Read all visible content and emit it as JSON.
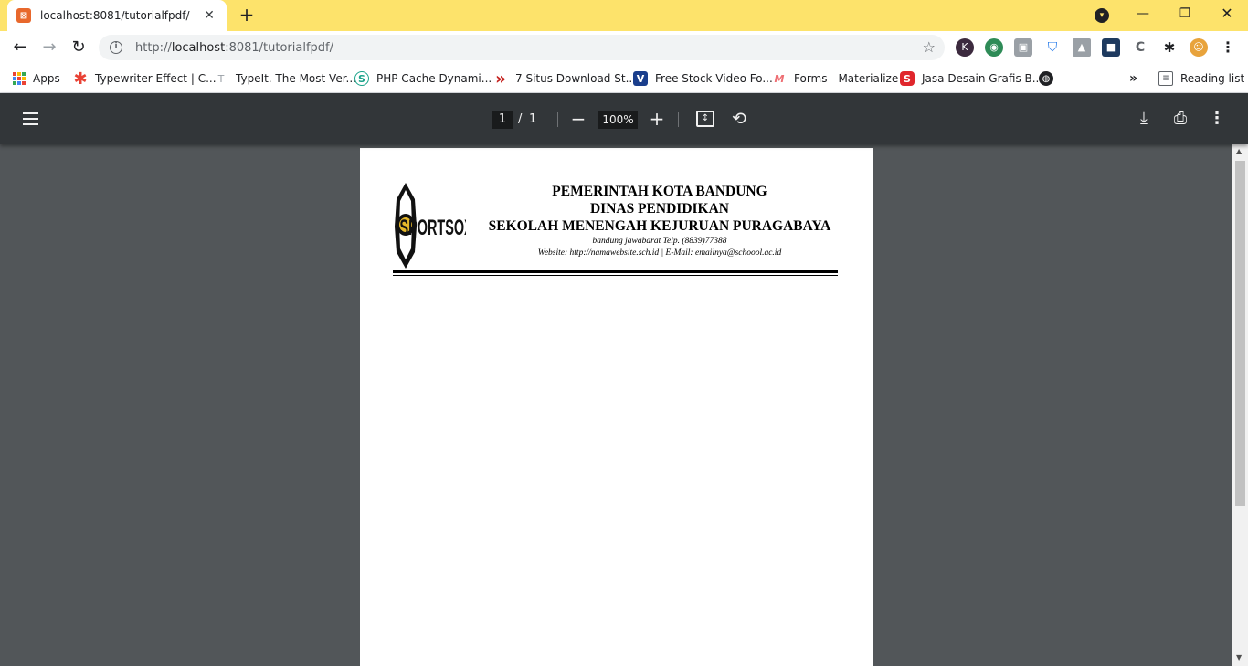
{
  "browser": {
    "tab_title": "localhost:8081/tutorialfpdf/",
    "tab_close": "✕",
    "new_tab": "+",
    "url_prefix": "http://",
    "url_host": "localhost",
    "url_rest": ":8081/tutorialfpdf/",
    "favicon_letter": "⊠"
  },
  "bookmarks": [
    {
      "label": "Apps",
      "icon": "apps-grid-icon"
    },
    {
      "label": "Typewriter Effect | C...",
      "icon": "asterisk-icon",
      "color": "#e94235"
    },
    {
      "label": "TypeIt. The Most Ver...",
      "icon": "t-letter-icon",
      "color": "#9aa0a6",
      "glyph": "T"
    },
    {
      "label": "PHP Cache Dynami...",
      "icon": "s-logo-icon",
      "color": "#1aa38a",
      "glyph": "S"
    },
    {
      "label": "7 Situs Download St...",
      "icon": "double-chevron-icon",
      "color": "#c5221f",
      "glyph": "»"
    },
    {
      "label": "Free Stock Video Fo...",
      "icon": "v-logo-icon",
      "color": "#1a3e8c",
      "glyph": "V"
    },
    {
      "label": "Forms - Materialize",
      "icon": "materialize-icon",
      "color": "#ee6e73",
      "glyph": "M"
    },
    {
      "label": "Jasa Desain Grafis B...",
      "icon": "s-red-icon",
      "color": "#e0262c",
      "glyph": "S"
    }
  ],
  "bookmarks_overflow": "»",
  "reading_list": "Reading list",
  "pdf_toolbar": {
    "page_current": "1",
    "page_separator": "/",
    "page_total": "1",
    "zoom": "100%"
  },
  "letterhead": {
    "logo_text": "SPORTSOX",
    "line1": "PEMERINTAH KOTA BANDUNG",
    "line2": "DINAS PENDIDIKAN",
    "line3": "SEKOLAH MENENGAH KEJURUAN PURAGABAYA",
    "address": "bandung jawabarat Telp. (8839)77388",
    "contact": "Website: http://namawebsite.sch.id | E-Mail: emailnya@schoool.ac.id"
  }
}
